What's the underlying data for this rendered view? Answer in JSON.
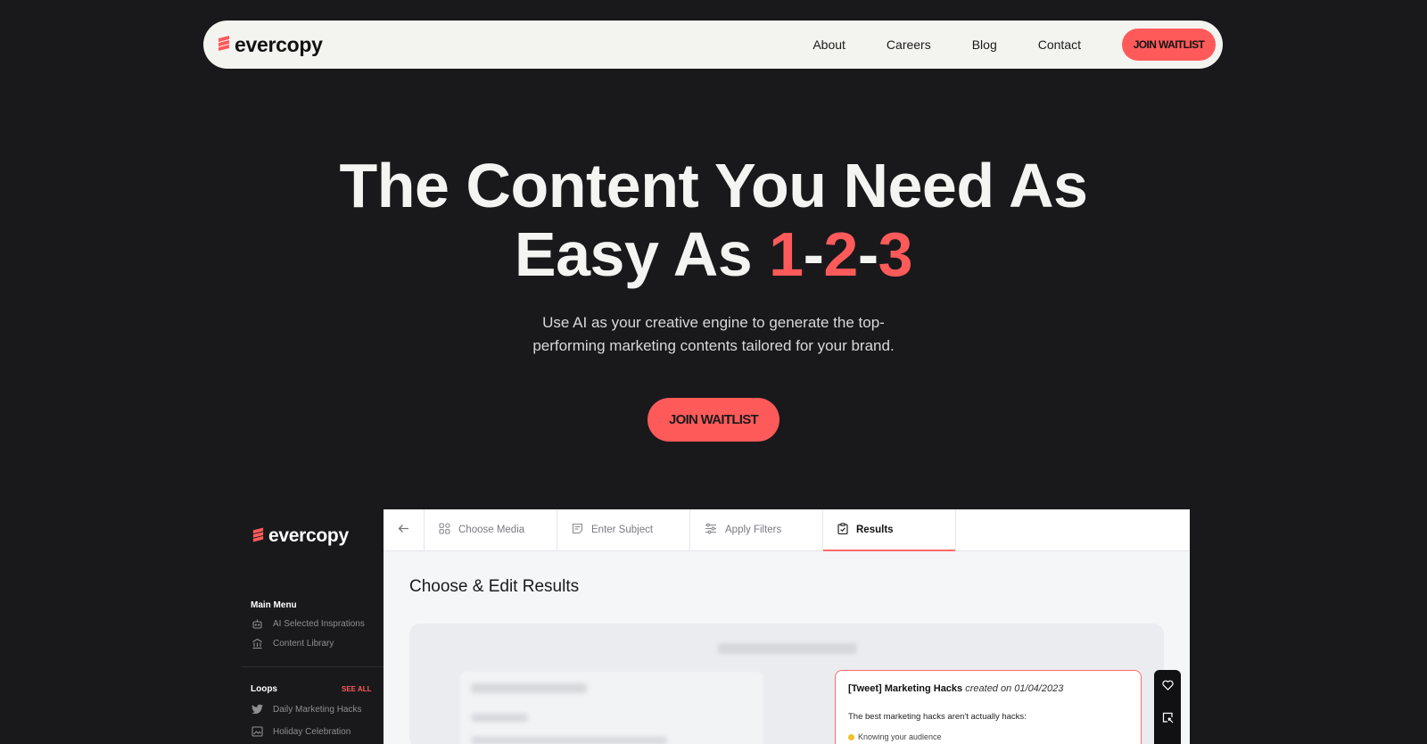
{
  "brand": {
    "name": "evercopy",
    "accent_color": "#ff5a5a"
  },
  "nav": {
    "links": [
      "About",
      "Careers",
      "Blog",
      "Contact"
    ],
    "cta_label": "JOIN WAITLIST"
  },
  "hero": {
    "title_line1": "The Content You Need As",
    "title_line2_prefix": "Easy As ",
    "title_numbers": [
      "1",
      "2",
      "3"
    ],
    "title_separator": "-",
    "subtitle": "Use AI as your creative engine to generate the top-performing marketing contents tailored for your brand.",
    "cta_label": "JOIN WAITLIST"
  },
  "preview": {
    "brand_name": "evercopy",
    "sidebar": {
      "main_menu_heading": "Main Menu",
      "main_menu_items": [
        {
          "label": "AI Selected Insprations",
          "icon": "robot-icon"
        },
        {
          "label": "Content Library",
          "icon": "library-icon"
        }
      ],
      "loops_heading": "Loops",
      "see_all_label": "SEE ALL",
      "loop_items": [
        {
          "label": "Daily Marketing Hacks",
          "icon": "twitter-icon"
        },
        {
          "label": "Holiday Celebration",
          "icon": "image-icon"
        }
      ]
    },
    "tabs": [
      {
        "label": "Choose Media",
        "icon": "grid-icon",
        "active": false
      },
      {
        "label": "Enter Subject",
        "icon": "note-icon",
        "active": false
      },
      {
        "label": "Apply Filters",
        "icon": "sliders-icon",
        "active": false
      },
      {
        "label": "Results",
        "icon": "clipboard-icon",
        "active": true
      }
    ],
    "main_title": "Choose & Edit Results",
    "result_card": {
      "title_bold": "[Tweet] Marketing Hacks",
      "title_meta": "created on 01/04/2023",
      "body": "The best marketing hacks aren't actually hacks:",
      "first_point": "Knowing your audience"
    }
  }
}
